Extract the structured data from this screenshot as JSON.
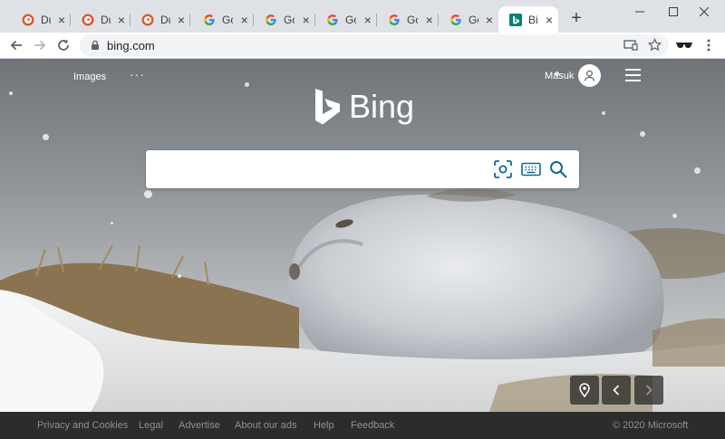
{
  "browser": {
    "tabs": [
      {
        "title": "Duc",
        "favicon": "duckduckgo-icon"
      },
      {
        "title": "Duc",
        "favicon": "duckduckgo-icon"
      },
      {
        "title": "Duc",
        "favicon": "duckduckgo-icon"
      },
      {
        "title": "Goc",
        "favicon": "google-icon"
      },
      {
        "title": "Goc",
        "favicon": "google-icon"
      },
      {
        "title": "Goc",
        "favicon": "google-icon"
      },
      {
        "title": "Goc",
        "favicon": "google-icon"
      },
      {
        "title": "Goc",
        "favicon": "google-icon"
      },
      {
        "title": "Bin",
        "favicon": "bing-icon",
        "active": true
      }
    ],
    "url": "bing.com"
  },
  "bing": {
    "nav": {
      "images": "Images",
      "more": "···"
    },
    "user": {
      "name": "Masuk"
    },
    "logo_text": "Bing",
    "search": {
      "value": "",
      "placeholder": ""
    }
  },
  "footer": {
    "links": [
      "Privacy and Cookies",
      "Legal",
      "Advertise",
      "About our ads",
      "Help",
      "Feedback"
    ],
    "copyright": "© 2020 Microsoft"
  },
  "colors": {
    "bing_teal": "#008373",
    "duckduckgo_orange": "#de5833",
    "tab_strip": "#dee1e6",
    "footer_bg": "#2b2c2d"
  }
}
